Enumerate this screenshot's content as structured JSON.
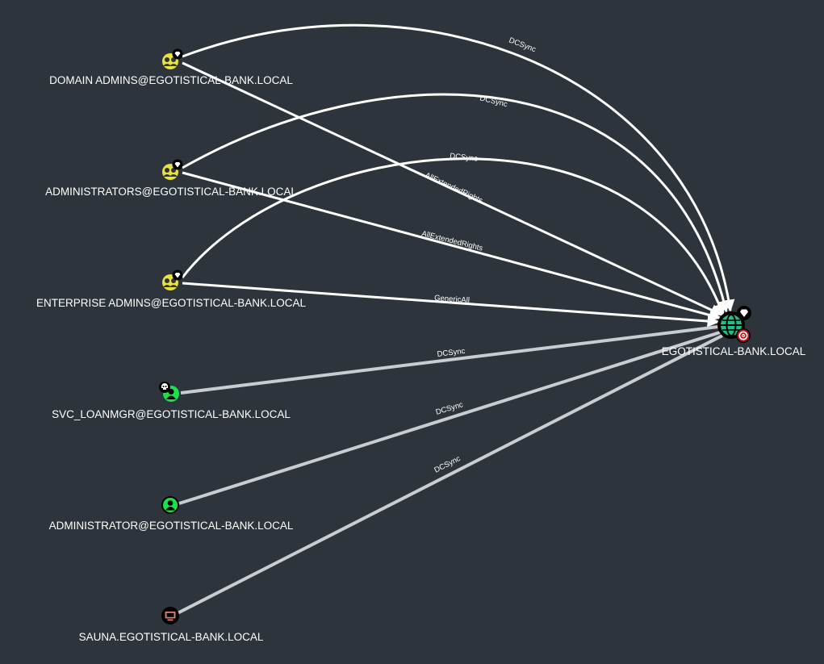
{
  "colors": {
    "background": "#2e343b",
    "group_icon": "#e8e23a",
    "user_icon": "#17e34b",
    "computer_icon": "#e07a6a",
    "domain_icon": "#1fbf8a",
    "target_ring": "#c1121f",
    "edge_primary": "#ffffff",
    "edge_secondary": "#c9ccd1"
  },
  "nodes": [
    {
      "id": "domain_admins",
      "type": "group",
      "icon": "group-icon",
      "badge": "high-value-diamond-icon",
      "label": "DOMAIN ADMINS@EGOTISTICAL-BANK.LOCAL"
    },
    {
      "id": "administrators",
      "type": "group",
      "icon": "group-icon",
      "badge": "high-value-diamond-icon",
      "label": "ADMINISTRATORS@EGOTISTICAL-BANK.LOCAL"
    },
    {
      "id": "enterprise_admins",
      "type": "group",
      "icon": "group-icon",
      "badge": "high-value-diamond-icon",
      "label": "ENTERPRISE ADMINS@EGOTISTICAL-BANK.LOCAL"
    },
    {
      "id": "svc_loanmgr",
      "type": "user",
      "icon": "user-icon",
      "badge": "owned-skull-icon",
      "label": "SVC_LOANMGR@EGOTISTICAL-BANK.LOCAL"
    },
    {
      "id": "administrator",
      "type": "user",
      "icon": "user-icon",
      "label": "ADMINISTRATOR@EGOTISTICAL-BANK.LOCAL"
    },
    {
      "id": "sauna",
      "type": "computer",
      "icon": "computer-icon",
      "label": "SAUNA.EGOTISTICAL-BANK.LOCAL"
    },
    {
      "id": "domain",
      "type": "domain",
      "icon": "globe-icon",
      "badge": "high-value-diamond-icon",
      "badge2": "target-icon",
      "label": "EGOTISTICAL-BANK.LOCAL"
    }
  ],
  "edges": [
    {
      "from": "domain_admins",
      "to": "domain",
      "label": "DCSync",
      "style": "primary"
    },
    {
      "from": "domain_admins",
      "to": "domain",
      "label": "AllExtendedRights",
      "style": "primary"
    },
    {
      "from": "administrators",
      "to": "domain",
      "label": "DCSync",
      "style": "primary"
    },
    {
      "from": "administrators",
      "to": "domain",
      "label": "AllExtendedRights",
      "style": "primary"
    },
    {
      "from": "enterprise_admins",
      "to": "domain",
      "label": "DCSync",
      "style": "primary"
    },
    {
      "from": "enterprise_admins",
      "to": "domain",
      "label": "GenericAll",
      "style": "primary"
    },
    {
      "from": "svc_loanmgr",
      "to": "domain",
      "label": "DCSync",
      "style": "secondary"
    },
    {
      "from": "administrator",
      "to": "domain",
      "label": "DCSync",
      "style": "secondary"
    },
    {
      "from": "sauna",
      "to": "domain",
      "label": "DCSync",
      "style": "secondary"
    }
  ]
}
